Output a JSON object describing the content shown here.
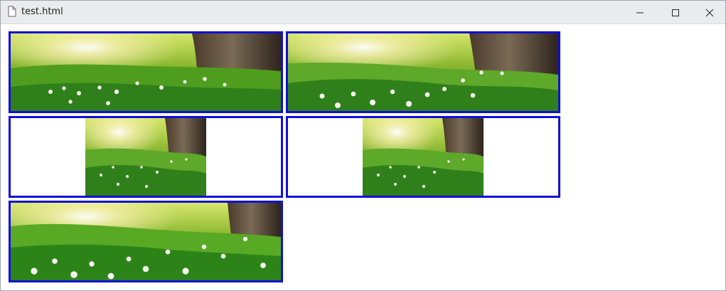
{
  "window": {
    "title": "test.html",
    "icons": {
      "file": "document-icon",
      "minimize": "minimize-icon",
      "maximize": "maximize-icon",
      "close": "close-icon"
    }
  },
  "gallery": {
    "border_color": "#1010d9",
    "images": [
      {
        "name": "meadow-image-cover"
      },
      {
        "name": "meadow-image-zoomed"
      },
      {
        "name": "meadow-image-contained"
      },
      {
        "name": "meadow-image-contained-duplicate"
      },
      {
        "name": "meadow-image-stretched"
      }
    ]
  }
}
